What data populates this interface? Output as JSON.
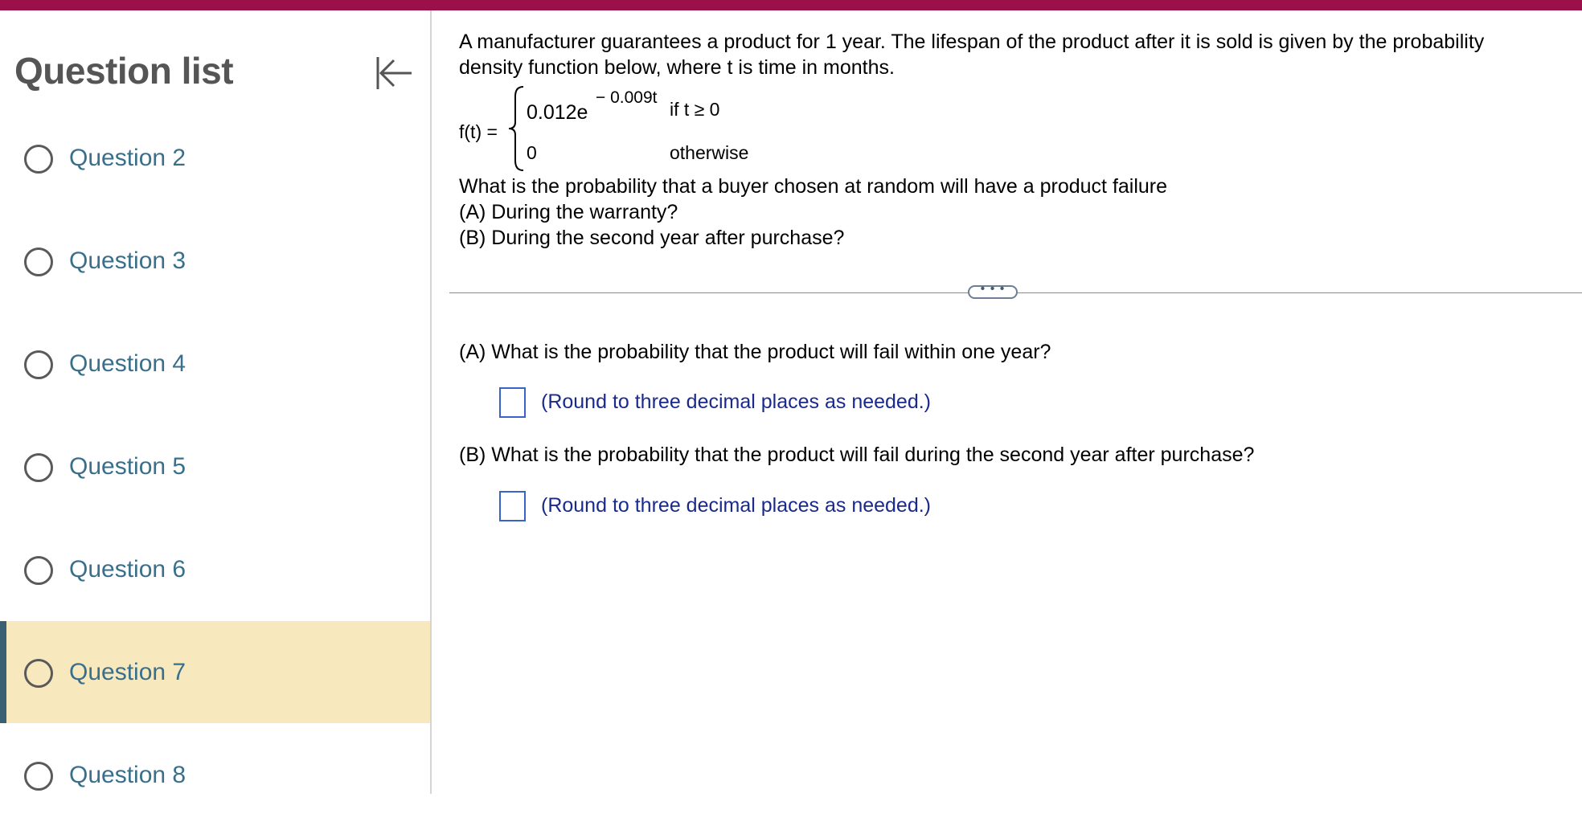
{
  "colors": {
    "topbar": "#9b1048",
    "active_item_bg": "#f7e9bd",
    "active_item_border": "#3b5f73",
    "question_link": "#3a6f8c",
    "hint_text": "#1a2a8c",
    "input_border": "#3a63c7"
  },
  "sidebar": {
    "title": "Question list",
    "collapse_icon": "collapse-left-arrow-icon",
    "items": [
      {
        "label": "Question 2",
        "active": false
      },
      {
        "label": "Question 3",
        "active": false
      },
      {
        "label": "Question 4",
        "active": false
      },
      {
        "label": "Question 5",
        "active": false
      },
      {
        "label": "Question 6",
        "active": false
      },
      {
        "label": "Question 7",
        "active": true
      },
      {
        "label": "Question 8",
        "active": false
      }
    ]
  },
  "problem": {
    "intro_line1": "A manufacturer guarantees a product for 1 year.  The lifespan of the product after it is sold is given by the probability",
    "intro_line2": "density function below, where t is time in months.",
    "function": {
      "name": "f(t) =",
      "case1_expr": "0.012e",
      "case1_exponent": "− 0.009t",
      "case1_condition": "if t ≥ 0",
      "case2_expr": "0",
      "case2_condition": "otherwise"
    },
    "question_line": "What is the probability that a buyer chosen at random will have a product failure",
    "sub_a": "(A)  During the warranty?",
    "sub_b": "(B)  During the second year after purchase?"
  },
  "divider_button": "• • •",
  "part_a": {
    "question": "(A)  What is the probability that the product will fail within one year?",
    "answer_value": "",
    "hint": "(Round to three decimal places as needed.)"
  },
  "part_b": {
    "question": "(B)  What is the probability that the product will fail during the second year after purchase?",
    "answer_value": "",
    "hint": "(Round to three decimal places as needed.)"
  }
}
